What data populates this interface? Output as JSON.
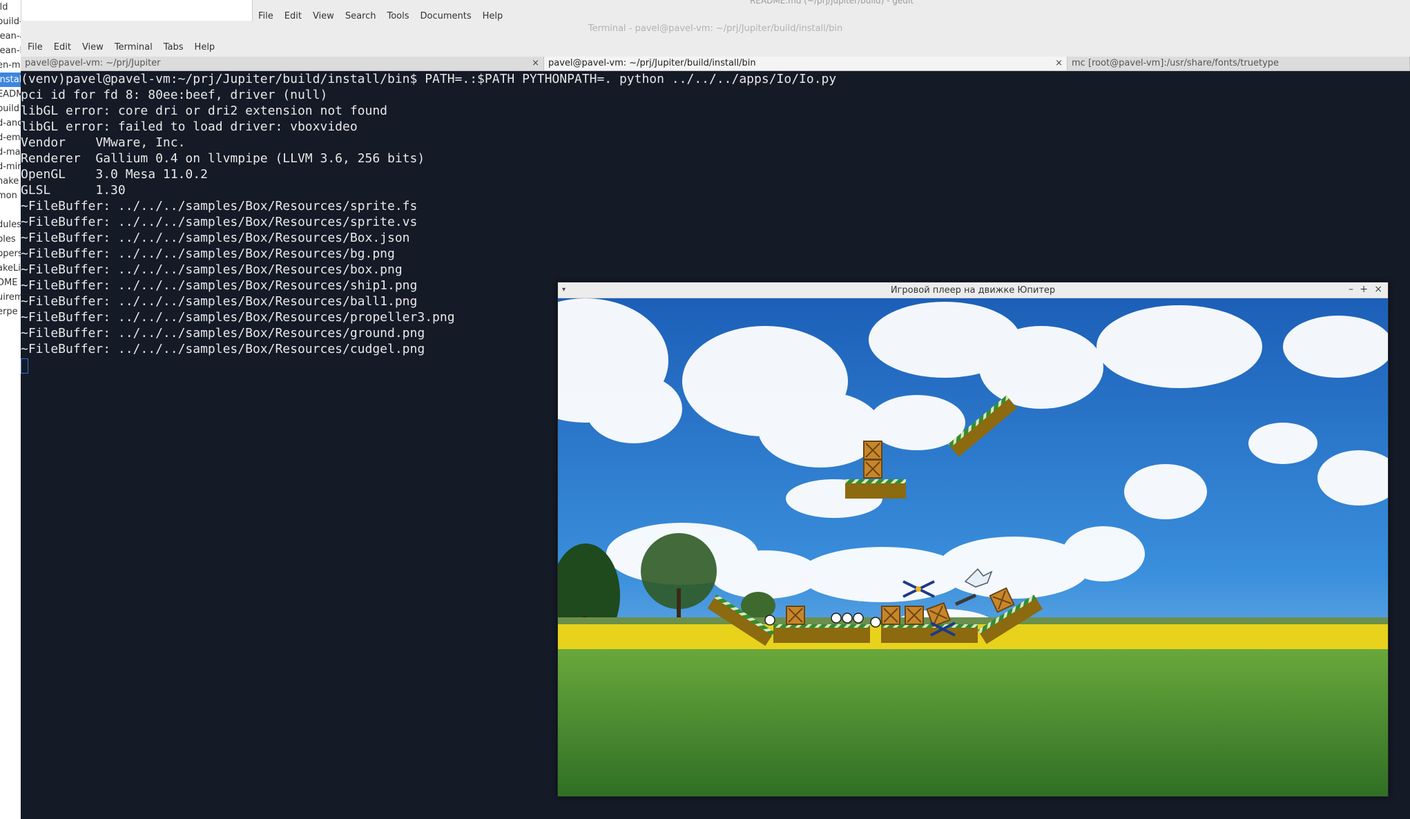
{
  "file_manager": {
    "items": [
      "ild",
      "build-a",
      "lean-a",
      "lean-h",
      "en-m",
      "instal",
      "EADM",
      "build",
      "d-anc",
      "d-em",
      "d-ma",
      "d-mir",
      "nake",
      "mon",
      "dules",
      "ples",
      "ppers",
      "akeLi",
      "DME",
      "uirem",
      "erpe"
    ],
    "selected_index": 5
  },
  "gedit": {
    "title": "README.md (~/prj/Jupiter/build) - gedit",
    "menu": [
      "File",
      "Edit",
      "View",
      "Search",
      "Tools",
      "Documents",
      "Help"
    ]
  },
  "terminal": {
    "title": "Terminal - pavel@pavel-vm: ~/prj/Jupiter/build/install/bin",
    "menu": [
      "File",
      "Edit",
      "View",
      "Terminal",
      "Tabs",
      "Help"
    ],
    "tabs": [
      {
        "label": "pavel@pavel-vm: ~/prj/Jupiter",
        "active": false,
        "close": "×"
      },
      {
        "label": "pavel@pavel-vm: ~/prj/Jupiter/build/install/bin",
        "active": true,
        "close": "×"
      },
      {
        "label": "mc [root@pavel-vm]:/usr/share/fonts/truetype",
        "active": false,
        "close": ""
      }
    ],
    "lines": [
      "(venv)pavel@pavel-vm:~/prj/Jupiter/build/install/bin$ PATH=.:$PATH PYTHONPATH=. python ../../../apps/Io/Io.py",
      "pci id for fd 8: 80ee:beef, driver (null)",
      "libGL error: core dri or dri2 extension not found",
      "libGL error: failed to load driver: vboxvideo",
      "Vendor    VMware, Inc.",
      "Renderer  Gallium 0.4 on llvmpipe (LLVM 3.6, 256 bits)",
      "OpenGL    3.0 Mesa 11.0.2",
      "GLSL      1.30",
      "~FileBuffer: ../../../samples/Box/Resources/sprite.fs",
      "~FileBuffer: ../../../samples/Box/Resources/sprite.vs",
      "~FileBuffer: ../../../samples/Box/Resources/Box.json",
      "~FileBuffer: ../../../samples/Box/Resources/bg.png",
      "~FileBuffer: ../../../samples/Box/Resources/box.png",
      "~FileBuffer: ../../../samples/Box/Resources/ship1.png",
      "~FileBuffer: ../../../samples/Box/Resources/ball1.png",
      "~FileBuffer: ../../../samples/Box/Resources/propeller3.png",
      "~FileBuffer: ../../../samples/Box/Resources/ground.png",
      "~FileBuffer: ../../../samples/Box/Resources/cudgel.png"
    ]
  },
  "game_window": {
    "title": "Игровой плеер на движке Юпитер",
    "menu_icon": "chevron-down-icon",
    "minimize": "–",
    "maximize": "+",
    "close": "×"
  },
  "colors": {
    "terminal_bg": "#141a26",
    "terminal_fg": "#e8e8e8",
    "sky": "#2f7fd4",
    "field_yellow": "#e8d21c",
    "grass": "#4a8a2e",
    "platform": "#8b6a10",
    "platform_stripe": "#3fa33a",
    "crate": "#c8862a"
  }
}
